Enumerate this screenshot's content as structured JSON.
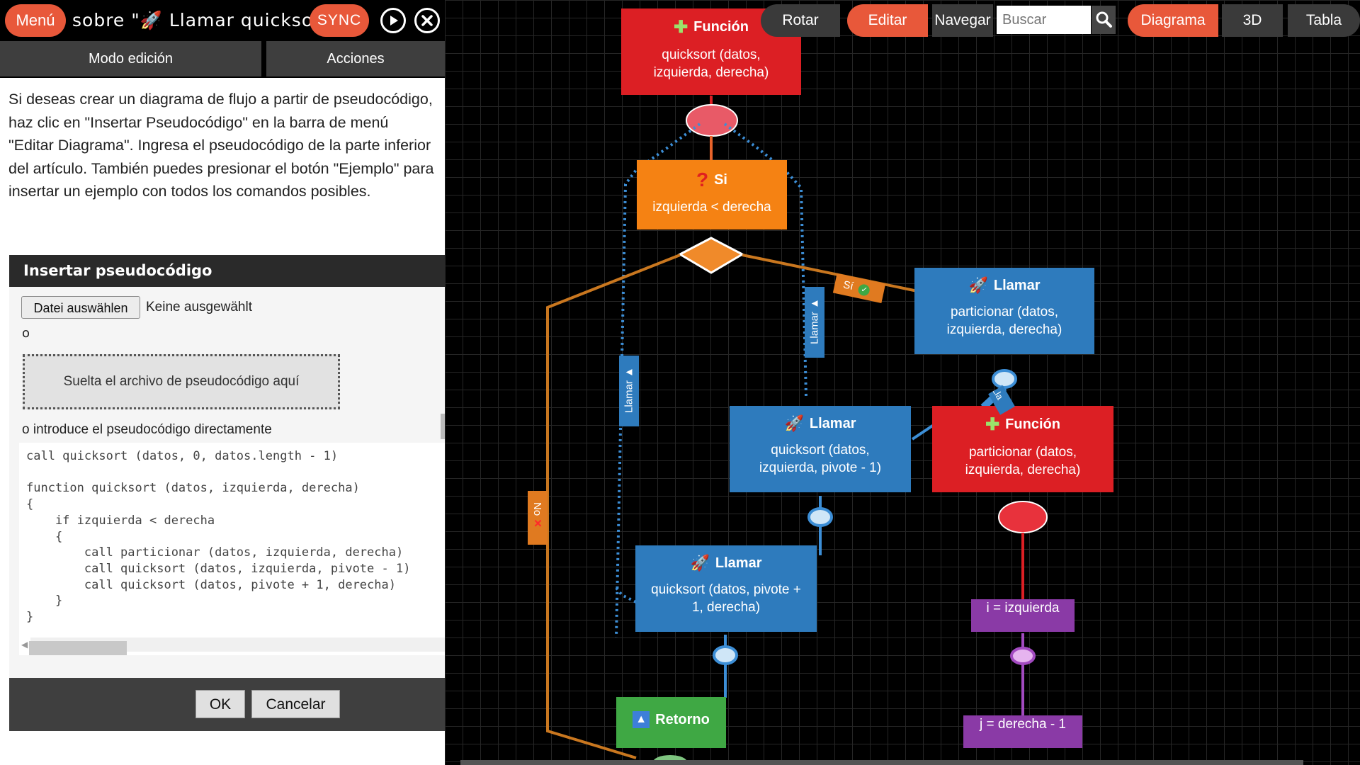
{
  "header": {
    "menu_label": "Menú",
    "title": "sobre \"🚀 Llamar quicksort",
    "sync_label": "SYNC"
  },
  "mode_tabs": {
    "edit_mode": "Modo edición",
    "actions": "Acciones"
  },
  "instructions": "Si deseas crear un diagrama de flujo a partir de pseudocódigo, haz clic en \"Insertar Pseudocódigo\" en la barra de menú \"Editar Diagrama\". Ingresa el pseudocódigo de la parte inferior del artículo. También puedes presionar el botón \"Ejemplo\" para insertar un ejemplo con todos los comandos posibles.",
  "dialog": {
    "title": "Insertar pseudocódigo",
    "file_button": "Datei auswählen",
    "file_status": "Keine ausgewählt",
    "or_label": "o",
    "drop_zone": "Suelta el archivo de pseudocódigo aquí",
    "or_direct": "o introduce el pseudocódigo directamente",
    "code": "call quicksort (datos, 0, datos.length - 1)\n\nfunction quicksort (datos, izquierda, derecha)\n{\n    if izquierda < derecha\n    {\n        call particionar (datos, izquierda, derecha)\n        call quicksort (datos, izquierda, pivote - 1)\n        call quicksort (datos, pivote + 1, derecha)\n    }\n}",
    "ok_label": "OK",
    "cancel_label": "Cancelar"
  },
  "toolbar": {
    "rotate": "Rotar",
    "edit": "Editar",
    "navigate": "Navegar",
    "search_placeholder": "Buscar",
    "diagram": "Diagrama",
    "three_d": "3D",
    "table": "Tabla"
  },
  "diagram": {
    "nodes": {
      "func_quicksort": {
        "title": "Función",
        "body": "quicksort (datos, izquierda, derecha)"
      },
      "if_node": {
        "title": "Si",
        "body": "izquierda < derecha"
      },
      "call_particionar": {
        "title": "Llamar",
        "body": "particionar (datos, izquierda, derecha)"
      },
      "call_qs_left": {
        "title": "Llamar",
        "body": "quicksort (datos, izquierda, pivote - 1)"
      },
      "func_particionar": {
        "title": "Función",
        "body": "particionar (datos, izquierda, derecha)"
      },
      "call_qs_right": {
        "title": "Llamar",
        "body": "quicksort (datos, pivote + 1, derecha)"
      },
      "return_node": {
        "title": "Retorno"
      },
      "assign_i": {
        "body": "i = izquierda"
      },
      "assign_j": {
        "body": "j = derecha - 1"
      }
    },
    "edge_labels": {
      "yes": "Sí",
      "no": "No",
      "call_1": "Llamar",
      "call_2": "Llamar",
      "call_3": "Lla"
    }
  },
  "colors": {
    "accent": "#e8583a",
    "function": "#dc1f24",
    "decision": "#f58213",
    "call": "#2e7bbd",
    "return": "#3fa844",
    "assign": "#8a3aa6"
  }
}
